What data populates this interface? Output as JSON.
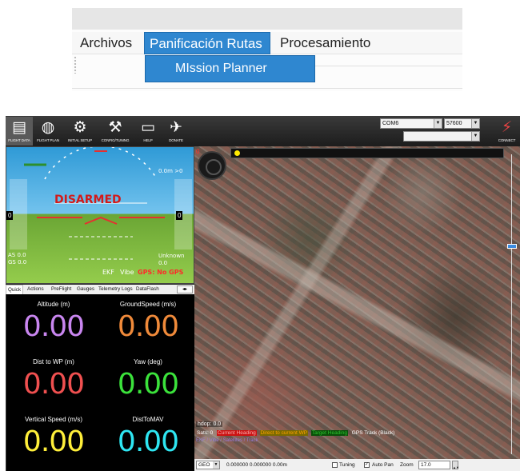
{
  "menu": {
    "items": [
      "Archivos",
      "Panificación Rutas",
      "Procesamiento"
    ],
    "dropdown_item": "MIssion Planner"
  },
  "toolbar": {
    "buttons": [
      {
        "label": "FLIGHT DATA",
        "icon": "flight-data-icon",
        "glyph": "▤"
      },
      {
        "label": "FLIGHT PLAN",
        "icon": "globe-icon",
        "glyph": "◍"
      },
      {
        "label": "INITIAL SETUP",
        "icon": "setup-icon",
        "glyph": "⚙"
      },
      {
        "label": "CONFIG/TUNING",
        "icon": "wrench-icon",
        "glyph": "⚒"
      },
      {
        "label": "HELP",
        "icon": "help-monitor-icon",
        "glyph": "▭"
      },
      {
        "label": "DONATE",
        "icon": "donate-icon",
        "glyph": "✈"
      },
      {
        "label": "CONNECT",
        "icon": "connect-plug-icon",
        "glyph": "⚡"
      }
    ],
    "port": "COM6",
    "baud": "57600",
    "profile": ""
  },
  "hud": {
    "status": "DISARMED",
    "ekf": "EKF",
    "vibe": "Vibe",
    "gps": "GPS: No GPS",
    "airspeed": "AS 0.0",
    "groundspeed": "GS 0.0",
    "mode": "Unknown",
    "mode_value": "0.0",
    "wp": "0.0m >0",
    "speed_box": "0",
    "alt_box": "0"
  },
  "tabs": [
    "Quick",
    "Actions",
    "PreFlight",
    "Gauges",
    "Telemetry Logs",
    "DataFlash"
  ],
  "quick": [
    {
      "label": "Altitude (m)",
      "value": "0.00",
      "color": "#c986f0"
    },
    {
      "label": "GroundSpeed (m/s)",
      "value": "0.00",
      "color": "#f08a3a"
    },
    {
      "label": "Dist to WP (m)",
      "value": "0.00",
      "color": "#f05050"
    },
    {
      "label": "Yaw (deg)",
      "value": "0.00",
      "color": "#3be23b"
    },
    {
      "label": "Vertical Speed (m/s)",
      "value": "0.00",
      "color": "#ffef3a"
    },
    {
      "label": "DistToMAV",
      "value": "0.00",
      "color": "#2ee6f2"
    }
  ],
  "map": {
    "top_value": "0",
    "hdop": "hdop: 0.0",
    "legend": {
      "sats": "Sats: 0",
      "current_heading": "Current Heading",
      "direct": "Direct to current WP",
      "target": "Target Heading",
      "gps_track": "GPS Track (Black)"
    },
    "footnote": "EKF / Vibe / Satellites / Track"
  },
  "statusbar": {
    "projection": "GEO",
    "coords": "0.000000 0.000000   0.00m",
    "tuning": "Tuning",
    "autopan": "Auto Pan",
    "zoom_label": "Zoom",
    "zoom": "17.0"
  }
}
